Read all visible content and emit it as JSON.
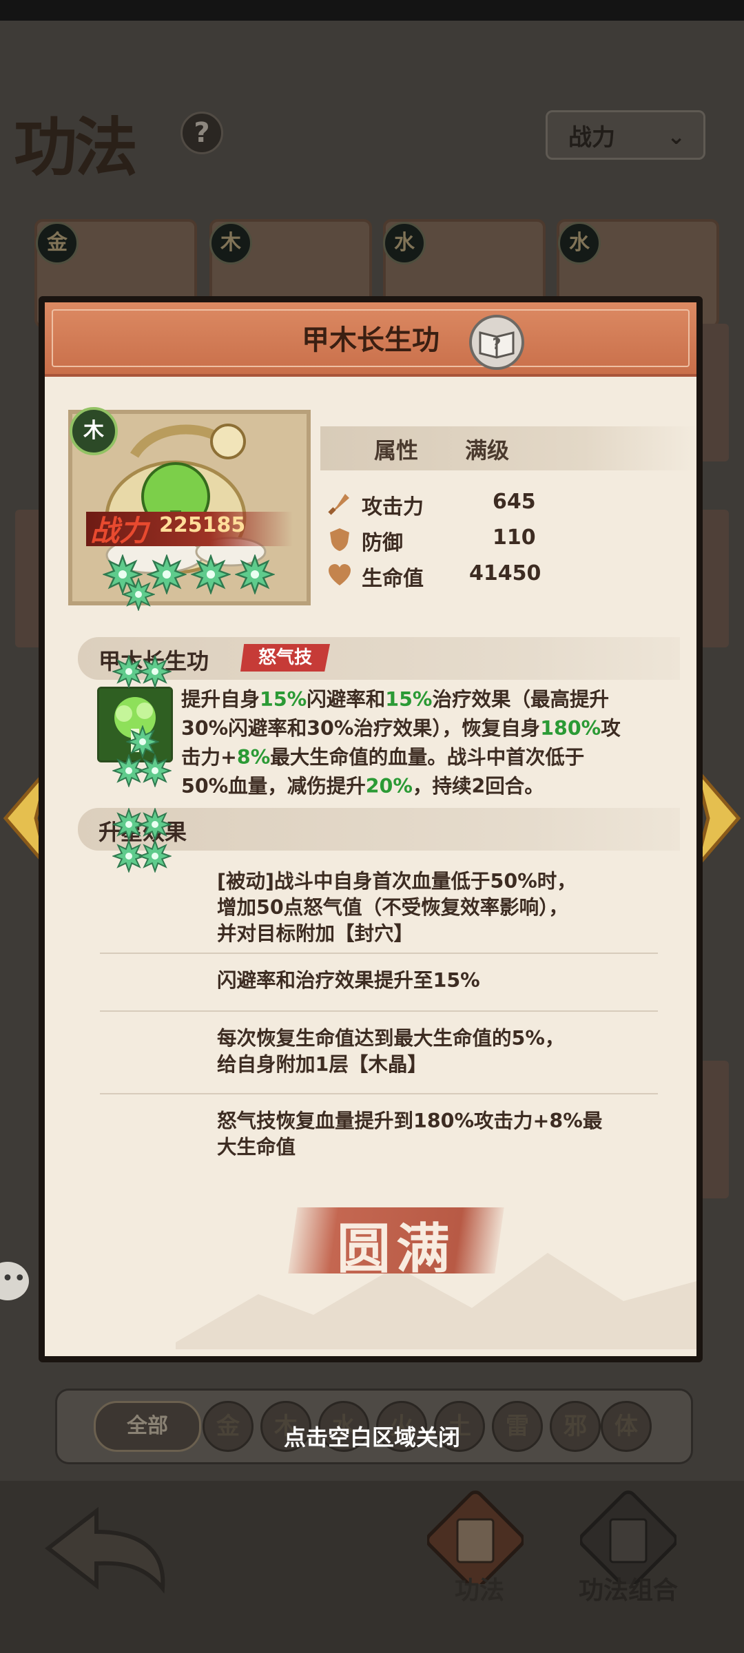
{
  "background": {
    "page_title": "功法",
    "help_label": "?",
    "sort": {
      "selected": "战力"
    },
    "cards": [
      {
        "element": "金"
      },
      {
        "element": "木"
      },
      {
        "element": "水"
      },
      {
        "element": "水"
      }
    ],
    "filters": {
      "all_label": "全部",
      "elements": [
        "金",
        "木",
        "水",
        "火",
        "土",
        "雷",
        "邪",
        "体"
      ]
    },
    "close_hint": "点击空白区域关闭",
    "bottom_tabs": [
      {
        "label": "功法",
        "active": true
      },
      {
        "label": "功法组合",
        "active": false
      }
    ]
  },
  "dialog": {
    "title": "甲木长生功",
    "element": "木",
    "power_label": "战力",
    "power_value": "225185",
    "stars": 4,
    "stats_header": {
      "attr": "属性",
      "level": "满级"
    },
    "stats": [
      {
        "name": "攻击力",
        "value": "645",
        "icon": "sword-icon"
      },
      {
        "name": "防御",
        "value": "110",
        "icon": "shield-icon"
      },
      {
        "name": "生命值",
        "value": "41450",
        "icon": "heart-icon"
      }
    ],
    "skill": {
      "name": "甲木长生功",
      "tag": "怒气技",
      "desc_parts": [
        [
          {
            "t": "提升自身"
          },
          {
            "t": "15%",
            "hl": true
          },
          {
            "t": "闪避率和"
          },
          {
            "t": "15%",
            "hl": true
          },
          {
            "t": "治疗效果（最高提升"
          }
        ],
        [
          {
            "t": "30%闪避率和30%治疗效果），恢复自身"
          },
          {
            "t": "180%",
            "hl": true
          },
          {
            "t": "攻"
          }
        ],
        [
          {
            "t": "击力+"
          },
          {
            "t": "8%",
            "hl": true
          },
          {
            "t": "最大生命值的血量。战斗中首次低于"
          }
        ],
        [
          {
            "t": "50%血量，减伤提升"
          },
          {
            "t": "20%",
            "hl": true
          },
          {
            "t": "，持续2回合。"
          }
        ]
      ]
    },
    "star_effects_title": "升星效果",
    "star_effects": [
      {
        "stars": 1,
        "text": "[被动]战斗中自身首次血量低于50%时，\n增加50点怒气值（不受恢复效率影响），\n并对目标附加【封穴】"
      },
      {
        "stars": 2,
        "text": "闪避率和治疗效果提升至15%"
      },
      {
        "stars": 3,
        "text": "每次恢复生命值达到最大生命值的5%，\n给自身附加1层【木晶】"
      },
      {
        "stars": 4,
        "text": "怒气技恢复血量提升到180%攻击力+8%最\n大生命值"
      }
    ],
    "status_stamp": "圆满",
    "colors": {
      "highlight": "#2b9a35",
      "header": "#c96f4a",
      "star": "#5fcb8c"
    }
  }
}
